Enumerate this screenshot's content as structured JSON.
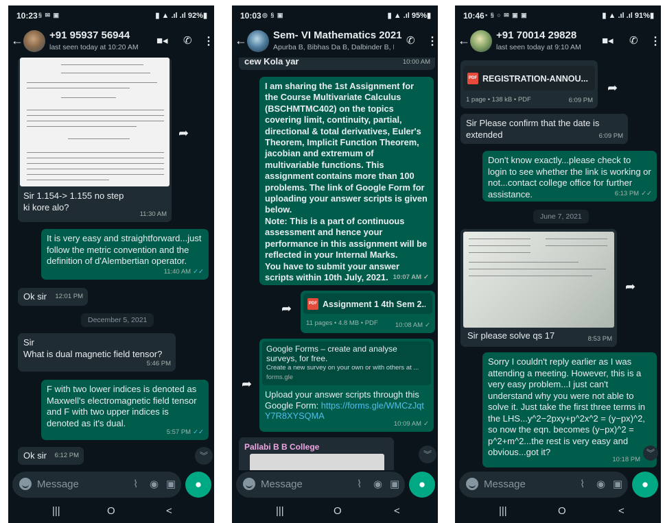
{
  "colors": {
    "chat_bg": "#0b141a",
    "incoming": "#202c33",
    "outgoing": "#005c4b",
    "accent": "#00a884",
    "link": "#53bdeb"
  },
  "common": {
    "composer_placeholder": "Message",
    "nav": {
      "recents": "|||",
      "home": "O",
      "back": "<"
    },
    "icons": [
      "back-arrow-icon",
      "video-call-icon",
      "phone-icon",
      "more-options-icon",
      "emoji-icon",
      "attach-icon",
      "payment-icon",
      "camera-icon",
      "mic-icon",
      "forward-icon",
      "pdf-icon",
      "double-tick-icon",
      "scroll-down-icon"
    ]
  },
  "phones": [
    {
      "status": {
        "time": "10:23",
        "battery": "92%"
      },
      "header": {
        "title": "+91 95937 56944",
        "subtitle": "last seen today at 10:20 AM"
      },
      "messages": [
        {
          "text": "Sir 1.154-> 1.155 no step ki kore alo?",
          "time": "11:30 AM"
        },
        {
          "text": "It is very easy and straightforward...just follow the metric convention and the definition of d'Alembertian operator.",
          "time": "11:40 AM"
        },
        {
          "text": "Ok sir",
          "time": "12:01 PM"
        },
        {
          "date": "December 5, 2021"
        },
        {
          "text": "Sir\nWhat is dual magnetic field tensor?",
          "time": "5:46 PM"
        },
        {
          "text": "F with two lower indices is denoted as Maxwell's electromagnetic field tensor and F with two upper indices is denoted as it's dual.",
          "time": "5:57 PM"
        },
        {
          "text": "Ok sir",
          "time": "6:12 PM"
        }
      ]
    },
    {
      "status": {
        "time": "10:03",
        "battery": "95%"
      },
      "header": {
        "title": "Sem- VI Mathematics 2021",
        "subtitle": "Apurba B, Bibhas Da B, Dalbinder B, Kusal..."
      },
      "messages": [
        {
          "text": "cew Kola yar",
          "time": "10:00 AM"
        },
        {
          "p1": "I am sharing the 1st Assignment for the Course Multivariate Calculus (BSCHMTMC402) on the topics covering limit, continuity, partial, directional & total derivatives, Euler's Theorem, Implicit Function Theorem, jacobian and extremum of multivariable functions. This assignment contains more than 100 problems. The link of Google Form for uploading your answer scripts is given below.",
          "p2a": "Note: This is a part of ",
          "p2b": "continuous assessment and hence your performance in this assignment will be reflected in your Internal Marks.",
          "p3a": "You have to submit your answer scripts ",
          "p3b": "within 10th July, 2021.",
          "time": "10:07 AM"
        },
        {
          "doc_name": "Assignment 1 4th Sem 2...",
          "meta": "11 pages • 4.8 MB • PDF",
          "time": "10:08 AM"
        },
        {
          "preview_title": "Google Forms – create and analyse surveys, for free.",
          "preview_desc": "Create a new survey on your own or with others at ...",
          "preview_url": "forms.gle",
          "text": "Upload your answer scripts through this Google Form: ",
          "link": "https://forms.gle/WMCzJqtY7R8XYSQMA",
          "time": "10:09 AM"
        },
        {
          "sender": "Pallabi B B College"
        }
      ]
    },
    {
      "status": {
        "time": "10:46",
        "battery": "91%"
      },
      "header": {
        "title": "+91 70014 29828",
        "subtitle": "last seen today at 9:10 AM"
      },
      "messages": [
        {
          "doc_name": "REGISTRATION-ANNOU...",
          "meta": "1 page • 138 kB • PDF",
          "time": "6:09 PM"
        },
        {
          "text": "Sir Please confirm that the date is extended",
          "time": "6:09 PM"
        },
        {
          "text": "Don't know exactly...please check to login to see whether the link is working or not...contact college office for further assistance.",
          "time": "6:13 PM"
        },
        {
          "date": "June 7, 2021"
        },
        {
          "text": "Sir please solve qs 17",
          "time": "8:53 PM"
        },
        {
          "text": "Sorry I couldn't reply earlier as I was attending a meeting. However, this is a very easy problem...I just can't understand why you were not able to solve it. Just take the first three terms in the LHS...y^2−2pxy+p^2x^2 = (y−px)^2, so now the eqn. becomes (y−px)^2 = p^2+m^2...the rest is very easy and obvious...got it?",
          "time": "10:18 PM"
        }
      ]
    }
  ]
}
